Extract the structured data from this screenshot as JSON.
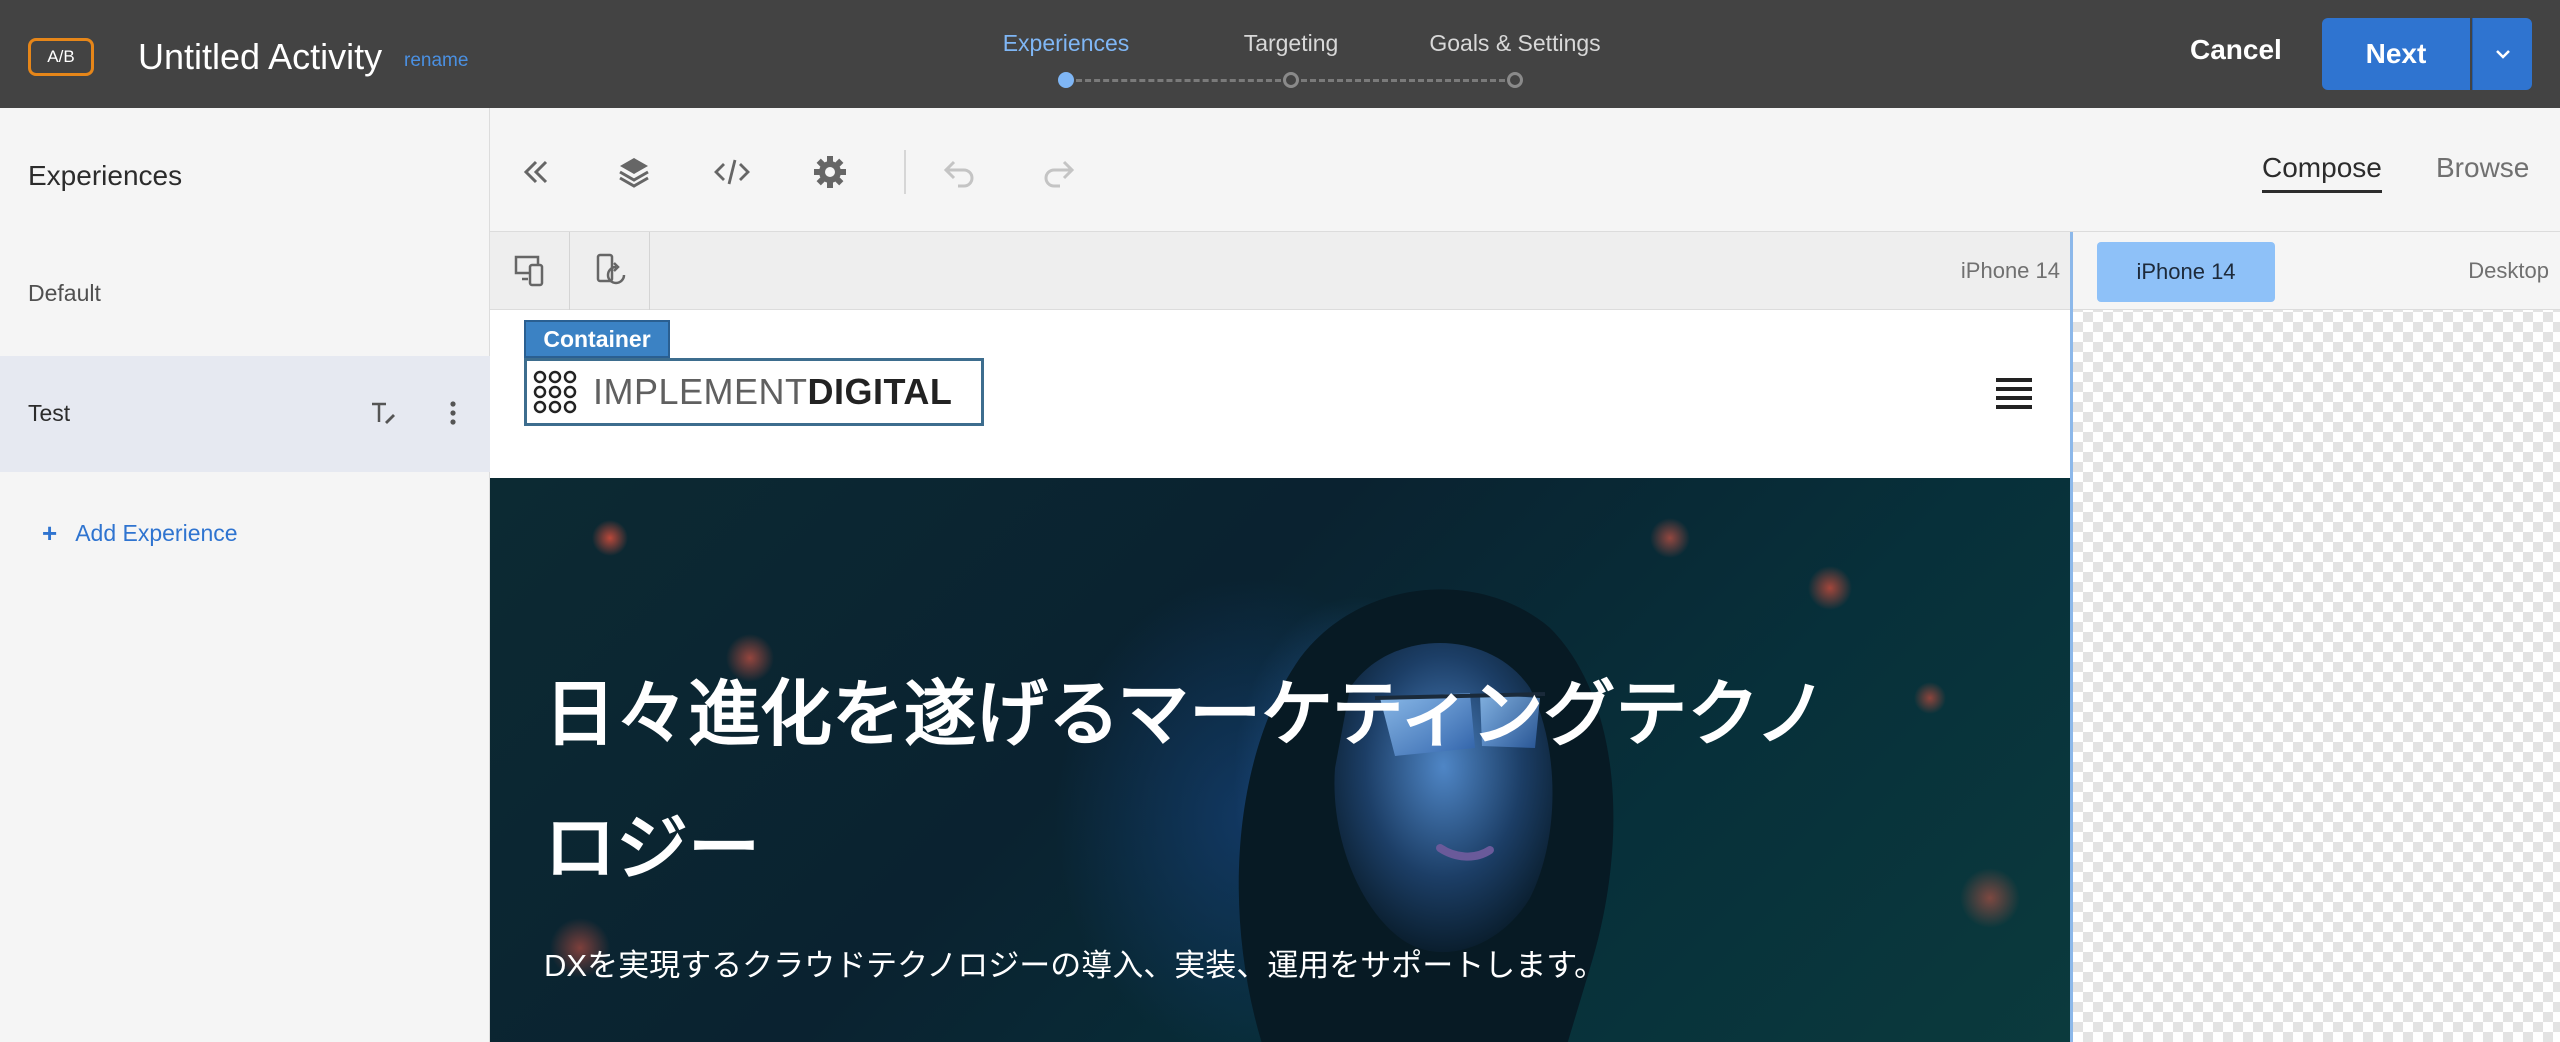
{
  "topbar": {
    "badge": "A/B",
    "activity_title": "Untitled Activity",
    "rename_label": "rename",
    "steps": [
      {
        "label": "Experiences",
        "active": true
      },
      {
        "label": "Targeting",
        "active": false
      },
      {
        "label": "Goals & Settings",
        "active": false
      }
    ],
    "cancel_label": "Cancel",
    "next_label": "Next"
  },
  "leftpanel": {
    "title": "Experiences",
    "experiences": [
      {
        "label": "Default",
        "selected": false
      },
      {
        "label": "Test",
        "selected": true
      }
    ],
    "add_label": "Add Experience"
  },
  "toolbar": {
    "icons": [
      "collapse-icon",
      "layers-icon",
      "code-icon",
      "gear-icon",
      "undo-icon",
      "redo-icon"
    ],
    "tabs": [
      {
        "label": "Compose",
        "active": true
      },
      {
        "label": "Browse",
        "active": false
      }
    ]
  },
  "devicebar": {
    "device_name": "iPhone 14"
  },
  "canvas": {
    "container_tag": "Container",
    "logo_thin": "IMPLEMENT",
    "logo_bold": "DIGITAL",
    "hero_title": "日々進化を遂げるマーケティングテクノロジー",
    "hero_subtitle": "DXを実現するクラウドテクノロジーの導入、実装、運用をサポートします。"
  },
  "rightpane": {
    "devices": [
      "iPhone 14",
      "Desktop"
    ],
    "selected_device": "iPhone 14"
  },
  "colors": {
    "topbar": "#434343",
    "accent_blue": "#2f74d0",
    "badge_orange": "#e68619",
    "active_step": "#7fb6f5",
    "container_tag": "#3b82c4"
  }
}
